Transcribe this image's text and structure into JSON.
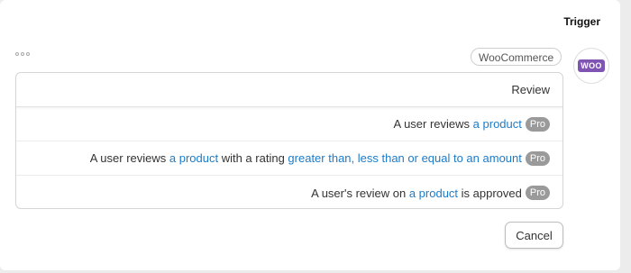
{
  "header": {
    "title": "Trigger"
  },
  "integration": {
    "name": "WooCommerce",
    "logo_text": "WOO",
    "icon": "woocommerce-logo-icon"
  },
  "menu": {
    "icon": "more-dots-icon"
  },
  "list": {
    "header": "Review",
    "items": [
      {
        "parts": [
          "A user reviews ",
          "a product"
        ],
        "badge": "Pro"
      },
      {
        "parts": [
          "A user reviews ",
          "a product",
          " with a rating ",
          "greater than, less than or equal to an amount"
        ],
        "badge": "Pro"
      },
      {
        "parts": [
          "A user's review on ",
          "a product",
          " is approved"
        ],
        "badge": "Pro"
      }
    ]
  },
  "footer": {
    "cancel_label": "Cancel"
  },
  "colors": {
    "link": "#1e7bc7",
    "pro_badge": "#9a9a9a",
    "woo_brand": "#7f54b3"
  }
}
